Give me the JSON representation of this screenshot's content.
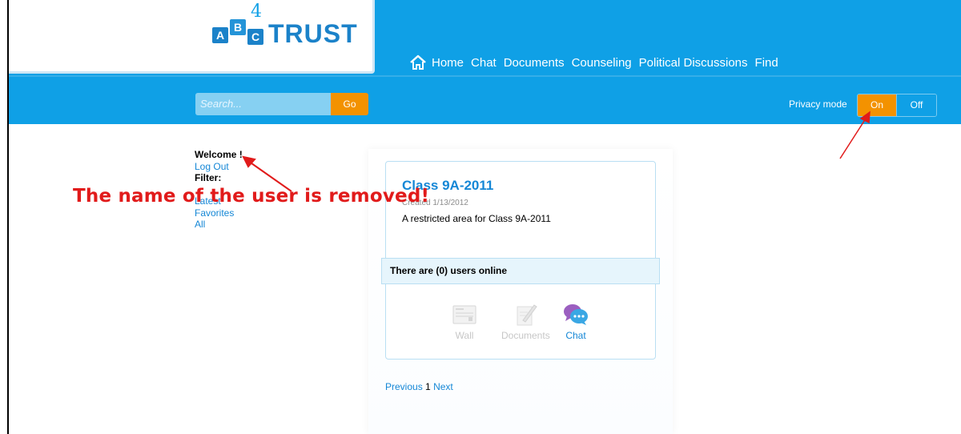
{
  "logo": {
    "tiles": [
      "A",
      "B",
      "C"
    ],
    "superscript": "4",
    "word": "TRUST"
  },
  "nav": {
    "items": [
      "Home",
      "Chat",
      "Documents",
      "Counseling",
      "Political Discussions",
      "Find"
    ]
  },
  "search": {
    "placeholder": "Search...",
    "button_label": "Go"
  },
  "privacy": {
    "label": "Privacy mode",
    "on_label": "On",
    "off_label": "Off",
    "selected": "On"
  },
  "sidebar": {
    "welcome": "Welcome !",
    "logout": "Log Out",
    "filter_label": "Filter:",
    "filters": [
      "Latest",
      "Favorites",
      "All"
    ]
  },
  "annotation": {
    "text": "The name of the user is removed!"
  },
  "card": {
    "title": "Class 9A-2011",
    "created": "Created 1/13/2012",
    "description": "A restricted area for Class 9A-2011",
    "online": "There are (0) users online",
    "categories": [
      {
        "label": "Wall",
        "icon": "wall-icon",
        "active": false
      },
      {
        "label": "Documents",
        "icon": "documents-icon",
        "active": false
      },
      {
        "label": "Chat",
        "icon": "chat-icon",
        "active": true
      }
    ]
  },
  "pager": {
    "previous": "Previous",
    "current": "1",
    "next": "Next"
  },
  "colors": {
    "header": "#0fa0e6",
    "accent": "#f39200",
    "link": "#1587d6",
    "annotation": "#e11b1b"
  }
}
